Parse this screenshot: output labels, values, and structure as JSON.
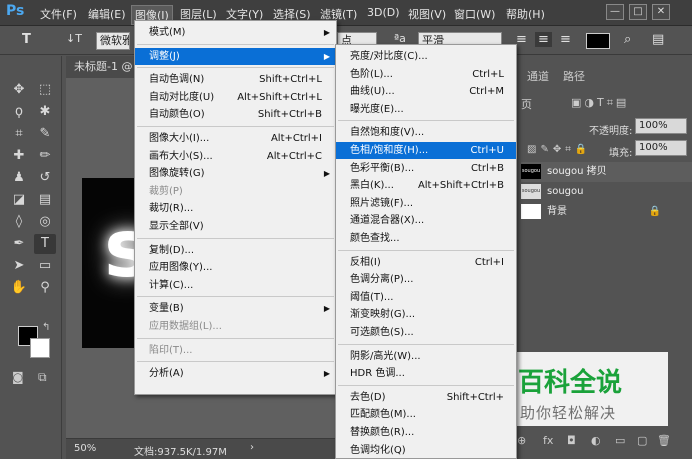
{
  "app": {
    "logo": "Ps"
  },
  "menubar": [
    {
      "label": "文件(F)"
    },
    {
      "label": "编辑(E)"
    },
    {
      "label": "图像(I)"
    },
    {
      "label": "图层(L)"
    },
    {
      "label": "文字(Y)"
    },
    {
      "label": "选择(S)"
    },
    {
      "label": "滤镜(T)"
    },
    {
      "label": "3D(D)"
    },
    {
      "label": "视图(V)"
    },
    {
      "label": "窗口(W)"
    },
    {
      "label": "帮助(H)"
    }
  ],
  "window_controls": {
    "minimize": "—",
    "restore": "□",
    "close": "✕"
  },
  "options": {
    "text_tool_glyph": "T",
    "orient_glyph": "↓T",
    "font_name": "微软雅",
    "size_suffix": "点",
    "aa_glyph": "ªa",
    "aa_mode": "平滑",
    "align_left": "≡",
    "align_center": "≡",
    "align_right": "≡",
    "color_swatch": "#000000"
  },
  "document": {
    "tab_title": "未标题-1 @",
    "zoom": "50%",
    "file_info": "文档:937.5K/1.97M",
    "status_arrow": "›",
    "canvas_text": "s"
  },
  "panel": {
    "tabs": [
      "通道",
      "路径"
    ],
    "opacity_label": "不透明度:",
    "opacity_value": "100%",
    "fill_label": "填充:",
    "fill_value": "100%",
    "kind_glyph": "页",
    "layers": [
      {
        "name": "sougou 拷贝",
        "thumb": "sougou"
      },
      {
        "name": "sougou",
        "thumb": "sougou"
      },
      {
        "name": "背景",
        "thumb": ""
      }
    ],
    "lock_icon_glyph": "🔒",
    "bottom_icons": [
      "⊕",
      "fx",
      "◘",
      "◐",
      "▭",
      "▢",
      "🗑"
    ]
  },
  "image_menu": [
    {
      "label": "模式(M)",
      "shortcut": "",
      "submenu": true
    },
    {
      "sep": true
    },
    {
      "label": "调整(J)",
      "shortcut": "",
      "submenu": true,
      "highlight": true
    },
    {
      "sep": true
    },
    {
      "label": "自动色调(N)",
      "shortcut": "Shift+Ctrl+L"
    },
    {
      "label": "自动对比度(U)",
      "shortcut": "Alt+Shift+Ctrl+L"
    },
    {
      "label": "自动颜色(O)",
      "shortcut": "Shift+Ctrl+B"
    },
    {
      "sep": true
    },
    {
      "label": "图像大小(I)...",
      "shortcut": "Alt+Ctrl+I"
    },
    {
      "label": "画布大小(S)...",
      "shortcut": "Alt+Ctrl+C"
    },
    {
      "label": "图像旋转(G)",
      "shortcut": "",
      "submenu": true
    },
    {
      "label": "裁剪(P)",
      "shortcut": "",
      "disabled": true
    },
    {
      "label": "裁切(R)...",
      "shortcut": ""
    },
    {
      "label": "显示全部(V)",
      "shortcut": ""
    },
    {
      "sep": true
    },
    {
      "label": "复制(D)...",
      "shortcut": ""
    },
    {
      "label": "应用图像(Y)...",
      "shortcut": ""
    },
    {
      "label": "计算(C)...",
      "shortcut": ""
    },
    {
      "sep": true
    },
    {
      "label": "变量(B)",
      "shortcut": "",
      "submenu": true
    },
    {
      "label": "应用数据组(L)...",
      "shortcut": "",
      "disabled": true
    },
    {
      "sep": true
    },
    {
      "label": "陷印(T)...",
      "shortcut": "",
      "disabled": true
    },
    {
      "sep": true
    },
    {
      "label": "分析(A)",
      "shortcut": "",
      "submenu": true
    }
  ],
  "adjust_menu": [
    {
      "label": "亮度/对比度(C)...",
      "shortcut": ""
    },
    {
      "label": "色阶(L)...",
      "shortcut": "Ctrl+L"
    },
    {
      "label": "曲线(U)...",
      "shortcut": "Ctrl+M"
    },
    {
      "label": "曝光度(E)...",
      "shortcut": ""
    },
    {
      "sep": true
    },
    {
      "label": "自然饱和度(V)...",
      "shortcut": ""
    },
    {
      "label": "色相/饱和度(H)...",
      "shortcut": "Ctrl+U",
      "highlight": true
    },
    {
      "label": "色彩平衡(B)...",
      "shortcut": "Ctrl+B"
    },
    {
      "label": "黑白(K)...",
      "shortcut": "Alt+Shift+Ctrl+B"
    },
    {
      "label": "照片滤镜(F)...",
      "shortcut": ""
    },
    {
      "label": "通道混合器(X)...",
      "shortcut": ""
    },
    {
      "label": "颜色查找...",
      "shortcut": ""
    },
    {
      "sep": true
    },
    {
      "label": "反相(I)",
      "shortcut": "Ctrl+I"
    },
    {
      "label": "色调分离(P)...",
      "shortcut": ""
    },
    {
      "label": "阈值(T)...",
      "shortcut": ""
    },
    {
      "label": "渐变映射(G)...",
      "shortcut": ""
    },
    {
      "label": "可选颜色(S)...",
      "shortcut": ""
    },
    {
      "sep": true
    },
    {
      "label": "阴影/高光(W)...",
      "shortcut": ""
    },
    {
      "label": "HDR 色调...",
      "shortcut": ""
    },
    {
      "sep": true
    },
    {
      "label": "去色(D)",
      "shortcut": "Shift+Ctrl+"
    },
    {
      "label": "匹配颜色(M)...",
      "shortcut": ""
    },
    {
      "label": "替换颜色(R)...",
      "shortcut": ""
    },
    {
      "label": "色调均化(Q)",
      "shortcut": ""
    }
  ],
  "watermark": {
    "title": "百科全说",
    "subtitle": "助你轻松解决"
  },
  "tools": [
    {
      "name": "move-tool",
      "glyph": "✥"
    },
    {
      "name": "marquee-tool",
      "glyph": "⬚"
    },
    {
      "name": "lasso-tool",
      "glyph": "ϙ"
    },
    {
      "name": "magic-wand-tool",
      "glyph": "✱"
    },
    {
      "name": "crop-tool",
      "glyph": "⌗"
    },
    {
      "name": "eyedropper-tool",
      "glyph": "✎"
    },
    {
      "name": "healing-tool",
      "glyph": "✚"
    },
    {
      "name": "brush-tool",
      "glyph": "✏"
    },
    {
      "name": "stamp-tool",
      "glyph": "♟"
    },
    {
      "name": "history-brush-tool",
      "glyph": "↺"
    },
    {
      "name": "eraser-tool",
      "glyph": "◪"
    },
    {
      "name": "gradient-tool",
      "glyph": "▤"
    },
    {
      "name": "blur-tool",
      "glyph": "◊"
    },
    {
      "name": "dodge-tool",
      "glyph": "◎"
    },
    {
      "name": "pen-tool",
      "glyph": "✒"
    },
    {
      "name": "type-tool",
      "glyph": "T"
    },
    {
      "name": "path-select-tool",
      "glyph": "➤"
    },
    {
      "name": "shape-tool",
      "glyph": "▭"
    },
    {
      "name": "hand-tool",
      "glyph": "✋"
    },
    {
      "name": "zoom-tool",
      "glyph": "⚲"
    }
  ]
}
